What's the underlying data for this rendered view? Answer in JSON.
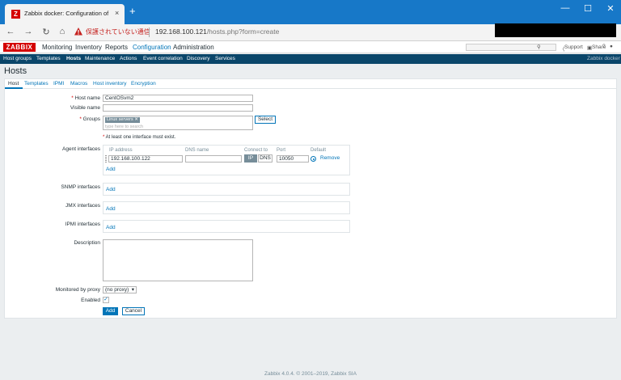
{
  "browser": {
    "tab_title": "Zabbix docker: Configuration of",
    "favicon_letter": "Z",
    "insecure_text": "保護されていない通信",
    "url_host": "192.168.100.121",
    "url_path": "/hosts.php?form=create",
    "new_tab_glyph": "+",
    "close_glyph": "×"
  },
  "topbar": {
    "logo": "ZABBIX",
    "menu": [
      "Monitoring",
      "Inventory",
      "Reports",
      "Configuration",
      "Administration"
    ],
    "active_menu": "Configuration",
    "support": "Support",
    "share": "Share",
    "help": "?"
  },
  "submenu": {
    "items": [
      "Host groups",
      "Templates",
      "Hosts",
      "Maintenance",
      "Actions",
      "Event correlation",
      "Discovery",
      "Services"
    ],
    "active": "Hosts",
    "server_name": "Zabbix docker"
  },
  "page": {
    "title": "Hosts"
  },
  "form": {
    "tabs": [
      "Host",
      "Templates",
      "IPMI",
      "Macros",
      "Host inventory",
      "Encryption"
    ],
    "active_tab": "Host",
    "host_name_label": "Host name",
    "host_name_value": "CentOSvm2",
    "visible_name_label": "Visible name",
    "groups_label": "Groups",
    "group_tag": "Linux servers",
    "group_placeholder": "type here to search",
    "select_button": "Select",
    "interface_note": "At least one interface must exist.",
    "agent_interfaces_label": "Agent interfaces",
    "iface_headers": {
      "ip": "IP address",
      "dns": "DNS name",
      "connect": "Connect to",
      "port": "Port",
      "default": "Default"
    },
    "agent_ip": "192.168.100.122",
    "agent_dns": "",
    "connect_ip": "IP",
    "connect_dns": "DNS",
    "agent_port": "10050",
    "remove_link": "Remove",
    "add_link": "Add",
    "snmp_label": "SNMP interfaces",
    "jmx_label": "JMX interfaces",
    "ipmi_label": "IPMI interfaces",
    "description_label": "Description",
    "proxy_label": "Monitored by proxy",
    "proxy_value": "(no proxy)",
    "enabled_label": "Enabled",
    "add_button": "Add",
    "cancel_button": "Cancel"
  },
  "footer": "Zabbix 4.0.4. © 2001–2019, Zabbix SIA",
  "colors": {
    "accent": "#0275b8",
    "brand": "#d40000",
    "nav": "#0a466a",
    "chrome": "#1778c8"
  }
}
